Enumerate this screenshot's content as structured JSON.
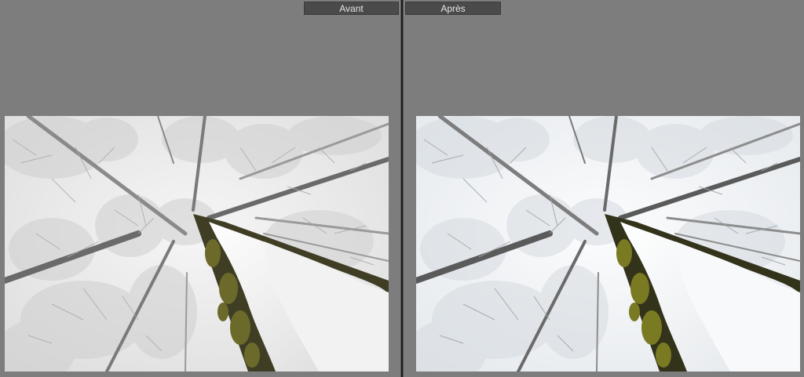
{
  "panes": {
    "before": {
      "label": "Avant"
    },
    "after": {
      "label": "Après"
    }
  },
  "colors": {
    "background": "#7d7d7d",
    "tab": "#4a4a4a",
    "tab_text": "#e6e6e6",
    "divider": "#1a1a1a",
    "sky_before": "#eeeeee",
    "sky_after": "#f4f6f8",
    "moss": "#6b6a2a"
  },
  "icons": {
    "photo_content": "snowy-forest-looking-up"
  }
}
